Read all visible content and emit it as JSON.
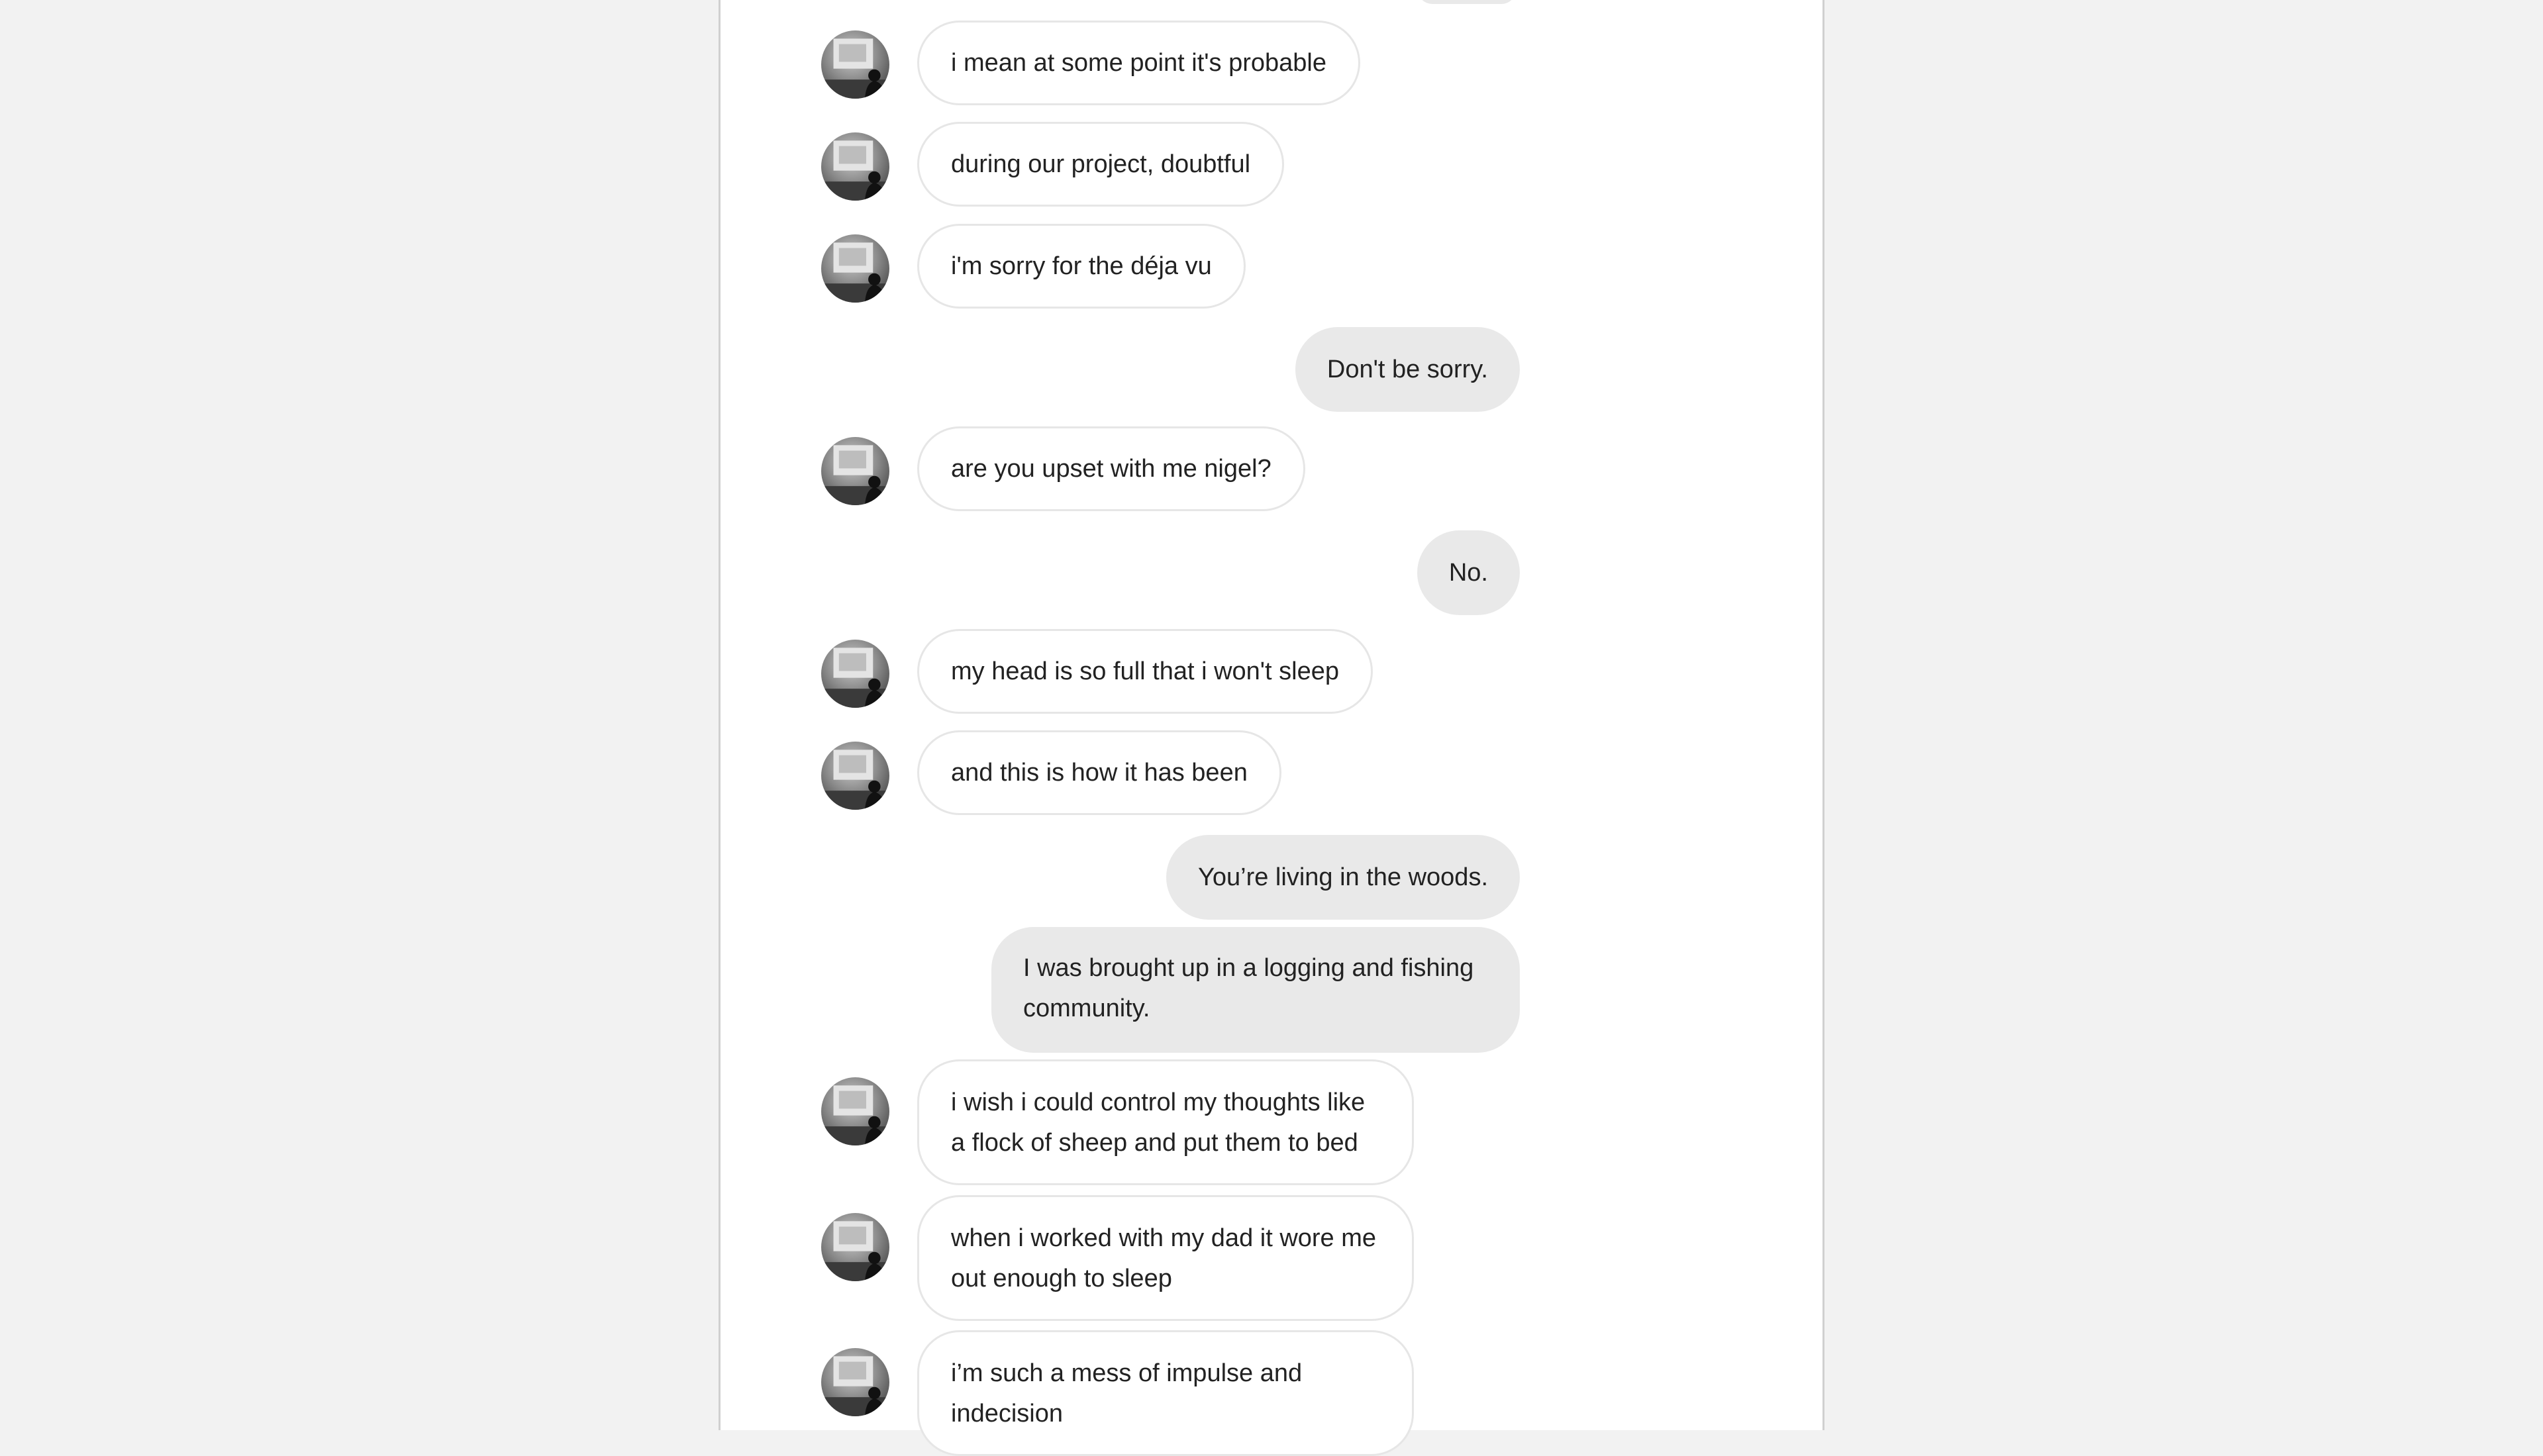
{
  "conversation": {
    "messages": [
      {
        "side": "in",
        "text": "i mean at some point it's probable"
      },
      {
        "side": "in",
        "text": "during our project, doubtful"
      },
      {
        "side": "in",
        "text": "i'm sorry for the déja vu"
      },
      {
        "side": "out",
        "text": "Don't be sorry."
      },
      {
        "side": "in",
        "text": "are you upset with me nigel?"
      },
      {
        "side": "out",
        "text": "No."
      },
      {
        "side": "in",
        "text": "my head is so full that i won't sleep"
      },
      {
        "side": "in",
        "text": "and this is how it has been"
      },
      {
        "side": "out",
        "text": "You’re living in the woods."
      },
      {
        "side": "out",
        "text": "I was brought up in a logging and fishing community."
      },
      {
        "side": "in",
        "text": "i wish i could control my thoughts like a flock of sheep and put them to bed"
      },
      {
        "side": "in",
        "text": "when i worked with my dad it wore me out enough to sleep"
      },
      {
        "side": "in",
        "text": "i’m such a mess of impulse and indecision"
      }
    ]
  },
  "icons": {
    "avatar": "avatar-photo-icon"
  }
}
